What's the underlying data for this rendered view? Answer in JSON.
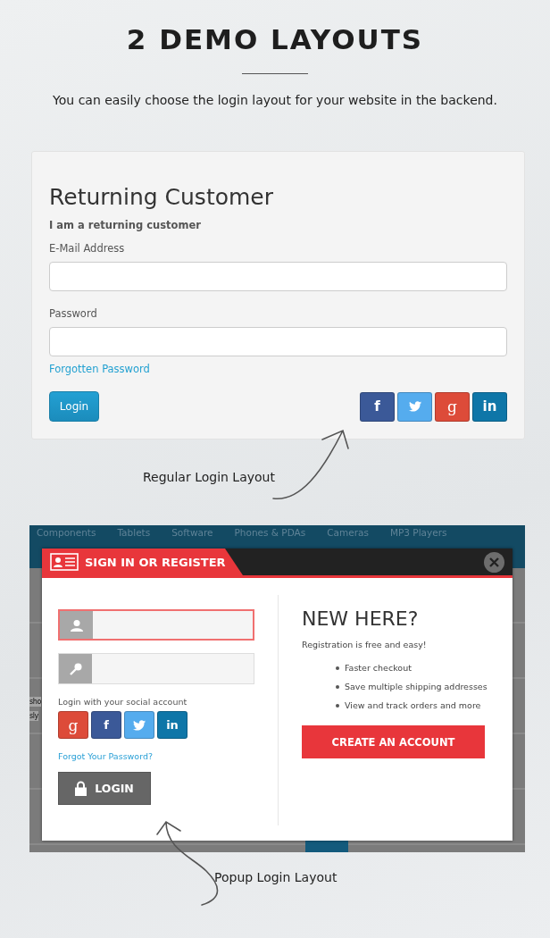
{
  "header": {
    "title": "2 DEMO LAYOUTS",
    "subtitle": "You can easily choose the login layout for your website in the backend."
  },
  "regular_login": {
    "heading": "Returning Customer",
    "subheading": "I am a returning customer",
    "fields": [
      {
        "label": "E-Mail Address"
      },
      {
        "label": "Password"
      }
    ],
    "forgot_link": "Forgotten Password",
    "login_button": "Login",
    "social_buttons": [
      {
        "kind": "facebook",
        "label": "f"
      },
      {
        "kind": "twitter"
      },
      {
        "kind": "google",
        "label": "g"
      },
      {
        "kind": "linkedin",
        "label": "in"
      }
    ],
    "caption": "Regular Login Layout"
  },
  "popup_login": {
    "nav_items": [
      "Components",
      "Tablets",
      "Software",
      "Phones & PDAs",
      "Cameras",
      "MP3 Players"
    ],
    "background_fragments": [
      "sho",
      "sly"
    ],
    "modal_title": "SIGN IN OR REGISTER",
    "fields": [
      {
        "kind": "user",
        "focused": true
      },
      {
        "kind": "key",
        "focused": false
      }
    ],
    "social_label": "Login with your social account",
    "social_buttons": [
      {
        "kind": "google",
        "label": "g"
      },
      {
        "kind": "facebook",
        "label": "f"
      },
      {
        "kind": "twitter"
      },
      {
        "kind": "linkedin",
        "label": "in"
      }
    ],
    "forgot_link": "Forgot Your Password?",
    "login_button": "LOGIN",
    "register_heading": "NEW HERE?",
    "register_text": "Registration is free and easy!",
    "benefits": [
      "Faster checkout",
      "Save multiple shipping addresses",
      "View and track orders and more"
    ],
    "register_button": "CREATE AN ACCOUNT",
    "caption": "Popup Login Layout"
  }
}
